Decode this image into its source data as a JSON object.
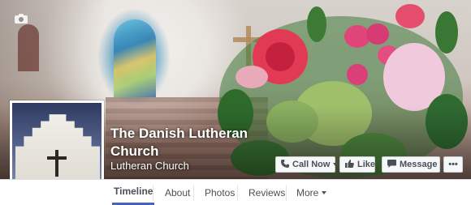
{
  "page": {
    "name": "The Danish Lutheran Church",
    "category": "Lutheran Church"
  },
  "actions": {
    "call_now": "Call Now",
    "like": "Like",
    "message": "Message",
    "more": "•••"
  },
  "tabs": [
    {
      "label": "Timeline",
      "active": true
    },
    {
      "label": "About",
      "active": false
    },
    {
      "label": "Photos",
      "active": false
    },
    {
      "label": "Reviews",
      "active": false
    },
    {
      "label": "More",
      "active": false
    }
  ],
  "icons": {
    "cover_camera": "camera-icon",
    "profile_camera": "camera-icon",
    "call": "phone-icon",
    "like": "thumbs-up-icon",
    "message": "message-icon"
  },
  "colors": {
    "accent": "#4267b2",
    "button_bg": "#f6f7f9",
    "button_text": "#4b4f56"
  }
}
